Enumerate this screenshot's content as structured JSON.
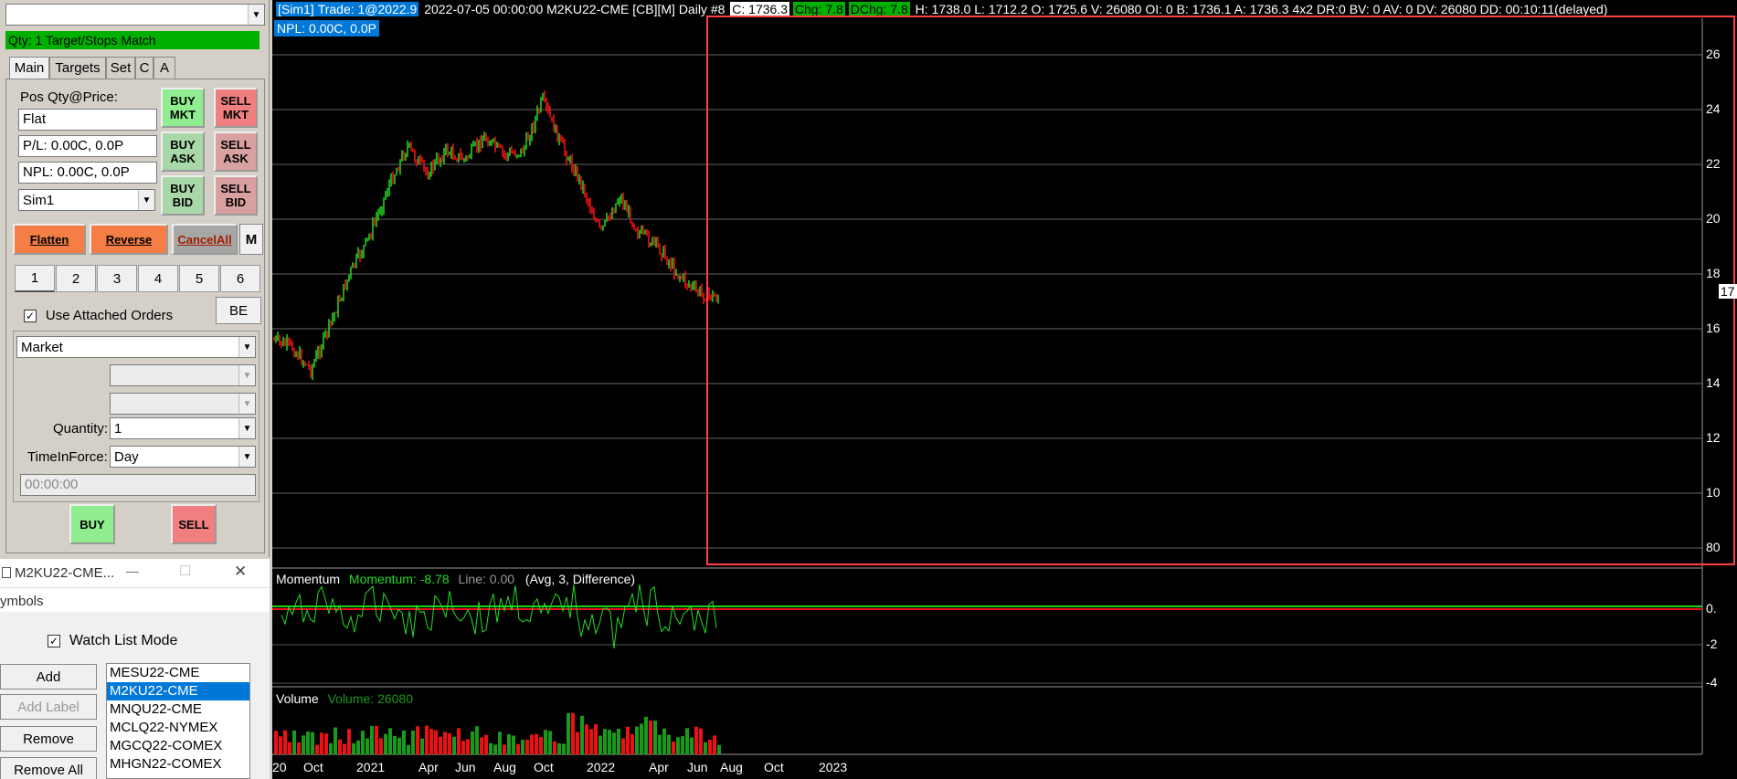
{
  "order_panel": {
    "top_combo_value": "",
    "status_bar": "Qty: 1 Target/Stops Match",
    "tabs": [
      "Main",
      "Targets",
      "Set",
      "C",
      "A"
    ],
    "pos_label": "Pos Qty@Price:",
    "pos_value": "Flat",
    "pl_value": "P/L: 0.00C, 0.0P",
    "npl_value": "NPL: 0.00C, 0.0P",
    "account": "Sim1",
    "buy_mkt": "BUY MKT",
    "sell_mkt": "SELL MKT",
    "buy_ask": "BUY ASK",
    "sell_ask": "SELL ASK",
    "buy_bid": "BUY BID",
    "sell_bid": "SELL BID",
    "flatten": "Flatten",
    "reverse": "Reverse",
    "cancel_all": "CancelAll",
    "m_button": "M",
    "preset_tabs": [
      "1",
      "2",
      "3",
      "4",
      "5",
      "6"
    ],
    "use_attached_label": "Use Attached Orders",
    "use_attached_checked": "✓",
    "be_button": "BE",
    "order_type": "Market",
    "quantity_label": "Quantity:",
    "quantity_value": "1",
    "tif_label": "TimeInForce:",
    "tif_value": "Day",
    "time_value": "00:00:00",
    "buy_button": "BUY",
    "sell_button": "SELL"
  },
  "watchlist_window": {
    "title": "M2KU22-CME...",
    "minimize": "—",
    "maximize": "☐",
    "close": "✕",
    "section_label": "ymbols",
    "watch_list_mode_label": "Watch List Mode",
    "watch_list_checked": "✓",
    "add": "Add",
    "add_label": "Add Label",
    "remove": "Remove",
    "remove_all": "Remove All",
    "symbols": [
      "MESU22-CME",
      "M2KU22-CME",
      "MNQU22-CME",
      "MCLQ22-NYMEX",
      "MGCQ22-COMEX",
      "MHGN22-COMEX"
    ],
    "selected_index": 1
  },
  "chart": {
    "header": {
      "account": "[Sim1]",
      "trade": "Trade: 1@2022.9",
      "info": "2022-07-05 00:00:00 M2KU22-CME [CB][M]  Daily  #8",
      "close": "C: 1736.3",
      "chg": "Chg: 7.8",
      "dchg": "DChg: 7.8",
      "rest": "H: 1738.0 L: 1712.2 O: 1725.6 V: 26080 OI: 0 B: 1736.1 A: 1736.3 4x2 DR:0 BV: 0 AV: 0 DV: 26080 DD: 00:10:11(delayed)",
      "npl": "NPL: 0.00C, 0.0P"
    },
    "y_labels": [
      "26",
      "24",
      "22",
      "20",
      "18",
      "17",
      "16",
      "14",
      "12",
      "10",
      "80"
    ],
    "momentum_title": "Momentum",
    "momentum_value": "Momentum: -8.78",
    "momentum_line": "Line: 0.00",
    "momentum_params": "(Avg, 3, Difference)",
    "momentum_y": [
      "0.",
      "-2",
      "-4"
    ],
    "volume_title": "Volume",
    "volume_value": "Volume: 26080",
    "x_labels": [
      "20",
      "Oct",
      "2021",
      "Apr",
      "Jun",
      "Aug",
      "Oct",
      "2022",
      "Apr",
      "Jun",
      "Aug",
      "Oct",
      "2023"
    ],
    "colors": {
      "up": "#22cc22",
      "down": "#ee1111",
      "selection": "#ff4040",
      "momentum": "#22dd22"
    }
  }
}
